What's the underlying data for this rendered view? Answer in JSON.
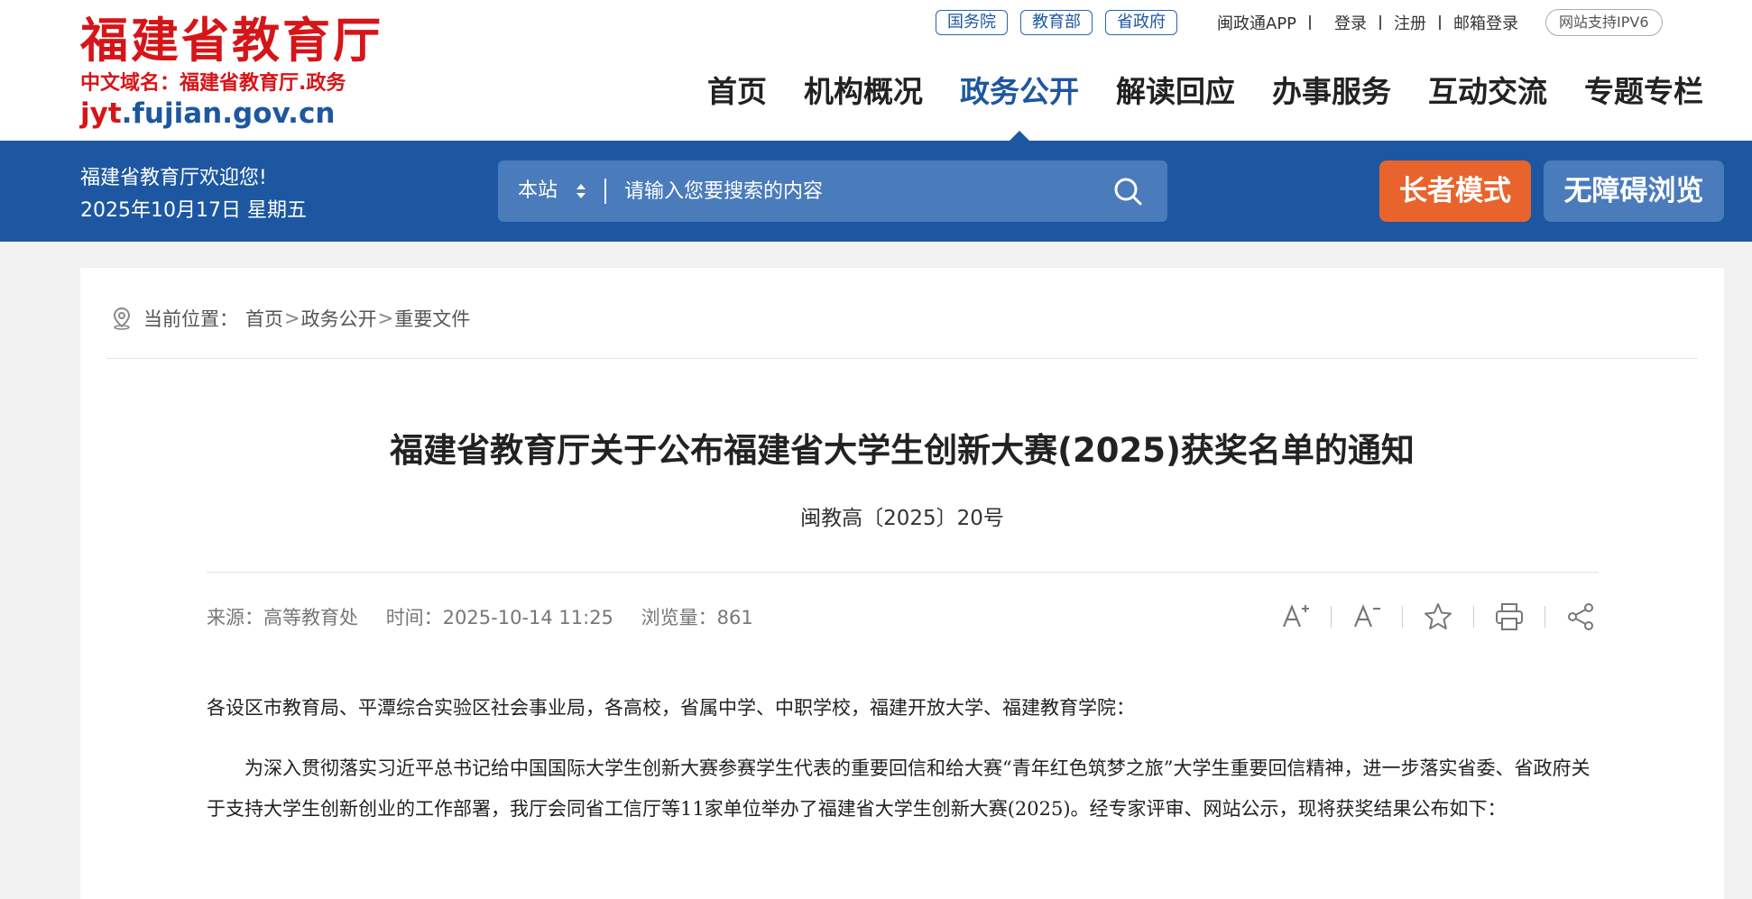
{
  "header": {
    "logo_title": "福建省教育厅",
    "logo_sub": "中文域名：福建省教育厅.政务",
    "logo_domain_prefix": "jyt",
    "logo_domain_rest": ".fujian.gov.cn",
    "pills": [
      "国务院",
      "教育部",
      "省政府"
    ],
    "links": [
      "闽政通APP",
      "登录",
      "注册",
      "邮箱登录"
    ],
    "ipv6": "网站支持IPV6",
    "nav": [
      "首页",
      "机构概况",
      "政务公开",
      "解读回应",
      "办事服务",
      "互动交流",
      "专题专栏"
    ],
    "active_nav": "政务公开"
  },
  "band": {
    "welcome": "福建省教育厅欢迎您!",
    "date": "2025年10月17日 星期五",
    "search_scope": "本站",
    "search_placeholder": "请输入您要搜索的内容",
    "elder_mode": "长者模式",
    "accessible": "无障碍浏览"
  },
  "breadcrumb": {
    "label": "当前位置：",
    "items": [
      "首页",
      "政务公开",
      "重要文件"
    ]
  },
  "article": {
    "title": "福建省教育厅关于公布福建省大学生创新大赛(2025)获奖名单的通知",
    "doc_no": "闽教高〔2025〕20号",
    "source": "来源：高等教育处",
    "time": "时间：2025-10-14 11:25",
    "views": "浏览量：861",
    "salutation": "各设区市教育局、平潭综合实验区社会事业局，各高校，省属中学、中职学校，福建开放大学、福建教育学院：",
    "para1": "为深入贯彻落实习近平总书记给中国国际大学生创新大赛参赛学生代表的重要回信和给大赛“青年红色筑梦之旅”大学生重要回信精神，进一步落实省委、省政府关于支持大学生创新创业的工作部署，我厅会同省工信厅等11家单位举办了福建省大学生创新大赛(2025)。经专家评审、网站公示，现将获奖结果公布如下："
  },
  "colors": {
    "brand_blue": "#1d57a1",
    "brand_red": "#d61518",
    "elder_orange": "#e8642c"
  }
}
